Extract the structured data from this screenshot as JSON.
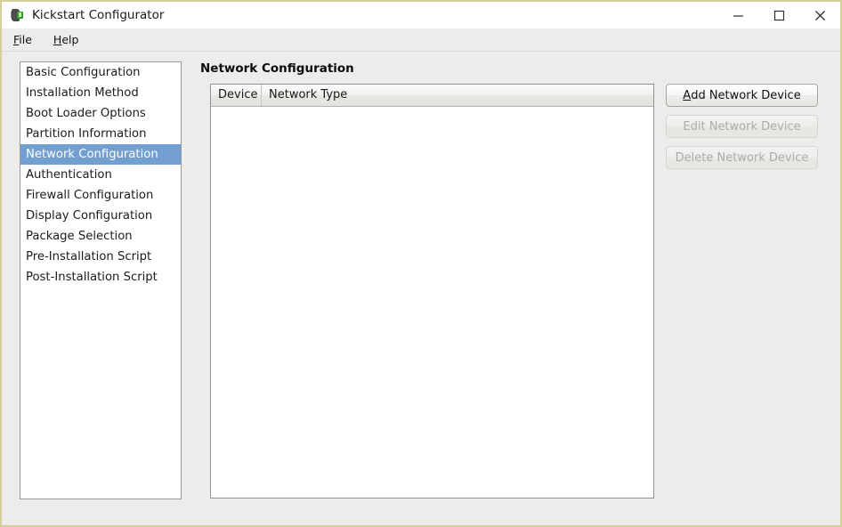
{
  "window": {
    "title": "Kickstart Configurator",
    "icon": "kickstart-app-icon",
    "controls": {
      "minimize": "minimize-icon",
      "maximize": "maximize-icon",
      "close": "close-icon"
    }
  },
  "menubar": {
    "items": [
      {
        "label": "File",
        "mnemonic": "F"
      },
      {
        "label": "Help",
        "mnemonic": "H"
      }
    ]
  },
  "sidebar": {
    "items": [
      {
        "label": "Basic Configuration",
        "selected": false
      },
      {
        "label": "Installation Method",
        "selected": false
      },
      {
        "label": "Boot Loader Options",
        "selected": false
      },
      {
        "label": "Partition Information",
        "selected": false
      },
      {
        "label": "Network Configuration",
        "selected": true
      },
      {
        "label": "Authentication",
        "selected": false
      },
      {
        "label": "Firewall Configuration",
        "selected": false
      },
      {
        "label": "Display Configuration",
        "selected": false
      },
      {
        "label": "Package Selection",
        "selected": false
      },
      {
        "label": "Pre-Installation Script",
        "selected": false
      },
      {
        "label": "Post-Installation Script",
        "selected": false
      }
    ]
  },
  "main": {
    "title": "Network Configuration",
    "table": {
      "columns": [
        "Device",
        "Network Type"
      ],
      "rows": []
    },
    "buttons": [
      {
        "label": "Add Network Device",
        "mnemonic": "A",
        "enabled": true
      },
      {
        "label": "Edit Network Device",
        "mnemonic": "",
        "enabled": false
      },
      {
        "label": "Delete Network Device",
        "mnemonic": "",
        "enabled": false
      }
    ]
  },
  "colors": {
    "window_border": "#d4d09a",
    "panel_bg": "#ececea",
    "selection_blue": "#729fcf",
    "disabled_text": "#adaba8"
  }
}
